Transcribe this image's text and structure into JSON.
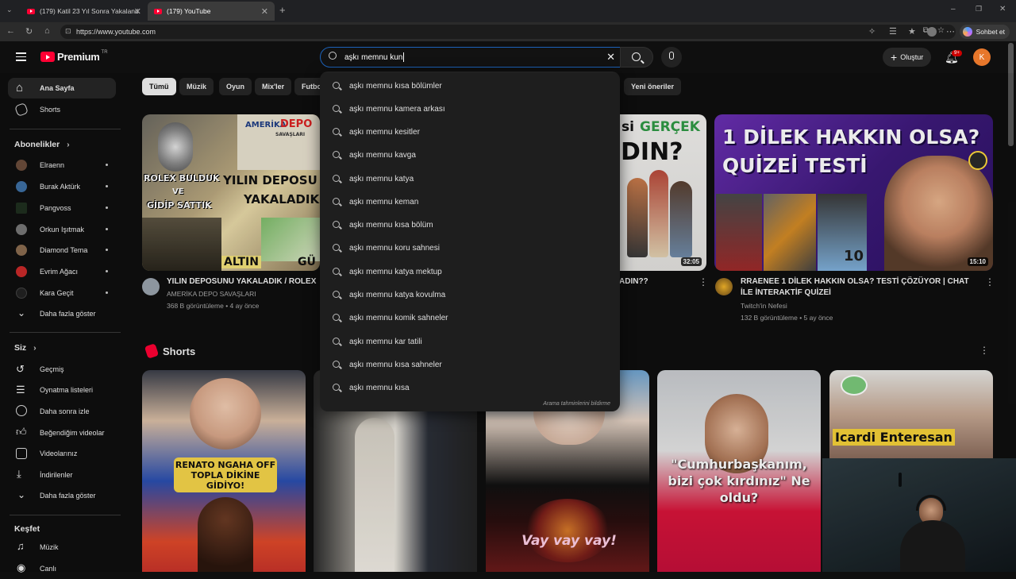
{
  "browser": {
    "tabs": [
      {
        "title": "(179) Katil 23 Yıl Sonra Yakalandığ",
        "active": false
      },
      {
        "title": "(179) YouTube",
        "active": true
      }
    ],
    "url": "https://www.youtube.com",
    "chat_label": "Sohbet et"
  },
  "masthead": {
    "logo": "Premium",
    "country": "TR",
    "search_value": "aşkı memnu kun",
    "create_label": "Oluştur",
    "notif_count": "9+",
    "avatar_letter": "K"
  },
  "sidebar": {
    "main": [
      {
        "label": "Ana Sayfa",
        "icon": "home-icon"
      },
      {
        "label": "Shorts",
        "icon": "shorts-icon"
      }
    ],
    "subs_title": "Abonelikler",
    "subs": [
      {
        "label": "Elraenn",
        "color": "#6b4c3b"
      },
      {
        "label": "Burak Aktürk",
        "color": "#3d6fa3"
      },
      {
        "label": "Pangvoss",
        "color": "#1f2f1f"
      },
      {
        "label": "Orkun Işıtmak",
        "color": "#777777"
      },
      {
        "label": "Diamond Tema",
        "color": "#8a6c50"
      },
      {
        "label": "Evrim Ağacı",
        "color": "#c92a2a"
      },
      {
        "label": "Kara Geçit",
        "color": "#222222"
      }
    ],
    "subs_more": "Daha fazla göster",
    "you_title": "Siz",
    "you": [
      {
        "label": "Geçmiş",
        "icon": "history-icon"
      },
      {
        "label": "Oynatma listeleri",
        "icon": "playlist-icon"
      },
      {
        "label": "Daha sonra izle",
        "icon": "clock-icon"
      },
      {
        "label": "Beğendiğim videolar",
        "icon": "like-icon"
      },
      {
        "label": "Videolarınız",
        "icon": "video-icon"
      },
      {
        "label": "İndirilenler",
        "icon": "download-icon"
      },
      {
        "label": "Daha fazla göster",
        "icon": "chevron-down-icon"
      }
    ],
    "explore_title": "Keşfet",
    "explore": [
      {
        "label": "Müzik",
        "icon": "music-icon"
      },
      {
        "label": "Canlı",
        "icon": "live-icon"
      }
    ]
  },
  "chips": [
    "Tümü",
    "Müzik",
    "Oyun",
    "Mix'ler",
    "Futbo",
    "Yeni öneriler"
  ],
  "videos": [
    {
      "title": "YILIN DEPOSUNU YAKALADIK / ROLEX",
      "channel": "AMERİKA DEPO SAVAŞLARI",
      "meta": "368 B görüntüleme • 4 ay önce",
      "thumb_text": [
        "ROLEX BULDUK",
        "VE",
        "GİDİP SATTIK",
        "YILIN DEPOSU",
        "YAKALADIK",
        "ALTIN",
        "GÜ",
        "AMERİKA",
        "DEPO",
        "SAVAŞLARI"
      ]
    },
    {
      "title": "ADIN??",
      "duration": "32:05",
      "thumb_text": [
        "si",
        "GERÇEK",
        "DIN?"
      ]
    },
    {
      "title": "RRAENEE 1 DİLEK HAKKIN OLSA? TESTİ ÇÖZÜYOR | CHAT İLE İNTERAKTİF QUİZEİ",
      "channel": "Twitch'in Nefesi",
      "meta": "132 B görüntüleme • 5 ay önce",
      "duration": "15:10",
      "thumb_text": [
        "1 DİLEK HAKKIN OLSA?",
        "QUİZEİ TESTİ",
        "10"
      ]
    }
  ],
  "shorts_title": "Shorts",
  "shorts": [
    {
      "caption": "RENATO NGAHA OFF TOPLA DİKİNE GİDİYO!"
    },
    {
      "caption": ""
    },
    {
      "caption": "Vay vay vay!"
    },
    {
      "caption": "\"Cumhurbaşkanım, bizi çok kırdınız\" Ne oldu?"
    },
    {
      "caption": "Icardi Enteresan"
    }
  ],
  "suggestions": [
    "aşkı memnu kısa bölümler",
    "aşkı memnu kamera arkası",
    "aşkı memnu kesitler",
    "aşkı memnu kavga",
    "aşkı memnu katya",
    "aşkı memnu keman",
    "aşkı memnu kısa bölüm",
    "aşkı memnu koru sahnesi",
    "aşkı memnu katya mektup",
    "aşkı memnu katya kovulma",
    "aşkı memnu komik sahneler",
    "aşkı memnu kar tatili",
    "aşkı memnu kısa sahneler",
    "aşkı memnu kısa"
  ],
  "report_label": "Arama tahminlerini bildirme"
}
